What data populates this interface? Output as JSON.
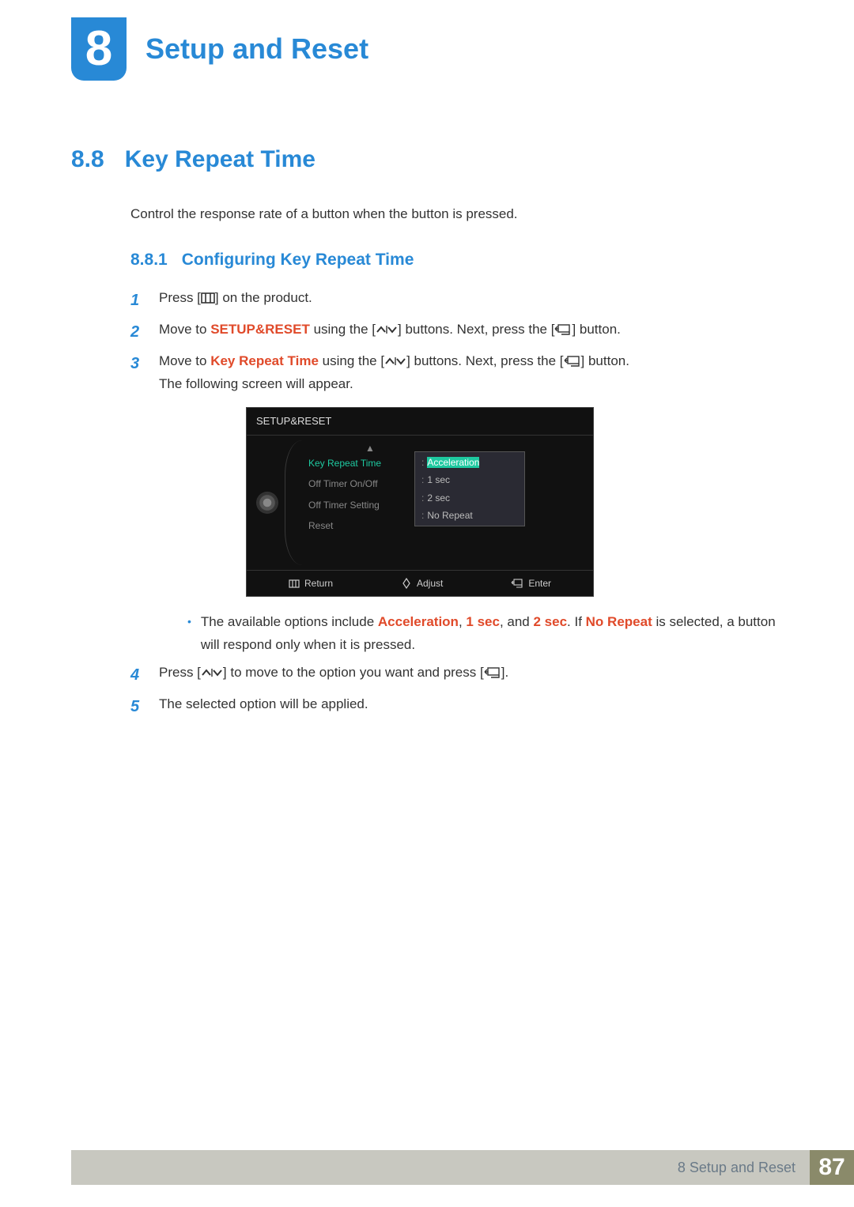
{
  "chapter": {
    "number": "8",
    "title": "Setup and Reset"
  },
  "section": {
    "number": "8.8",
    "title": "Key Repeat Time"
  },
  "intro": "Control the response rate of a button when the button is pressed.",
  "subsection": {
    "number": "8.8.1",
    "title": "Configuring Key Repeat Time"
  },
  "steps": {
    "s1": {
      "num": "1",
      "a": "Press [",
      "b": "] on the product."
    },
    "s2": {
      "num": "2",
      "a": "Move to ",
      "setup": "SETUP&RESET",
      "b": " using the [",
      "c": "] buttons. Next, press the [",
      "d": "] button."
    },
    "s3": {
      "num": "3",
      "a": "Move to ",
      "krt": "Key Repeat Time",
      "b": " using the [",
      "c": "] buttons. Next, press the [",
      "d": "] button.",
      "appear": "The following screen will appear."
    },
    "bullet": {
      "a": "The available options include ",
      "o1": "Acceleration",
      "comma1": ", ",
      "o2": "1 sec",
      "comma2": ", and ",
      "o3": "2 sec",
      "dot": ". If ",
      "o4": "No Repeat",
      "rest": " is selected, a button will respond only when it is pressed."
    },
    "s4": {
      "num": "4",
      "a": "Press [",
      "b": "] to move to the option you want and press [",
      "c": "]."
    },
    "s5": {
      "num": "5",
      "text": "The selected option will be applied."
    }
  },
  "osd": {
    "title": "SETUP&RESET",
    "menu": {
      "m1": "Key Repeat Time",
      "m2": "Off Timer On/Off",
      "m3": "Off Timer Setting",
      "m4": "Reset"
    },
    "options": {
      "o1": "Acceleration",
      "o2": "1 sec",
      "o3": "2 sec",
      "o4": "No Repeat"
    },
    "footer": {
      "return": "Return",
      "adjust": "Adjust",
      "enter": "Enter"
    }
  },
  "footer": {
    "label": "8 Setup and Reset",
    "page": "87"
  }
}
